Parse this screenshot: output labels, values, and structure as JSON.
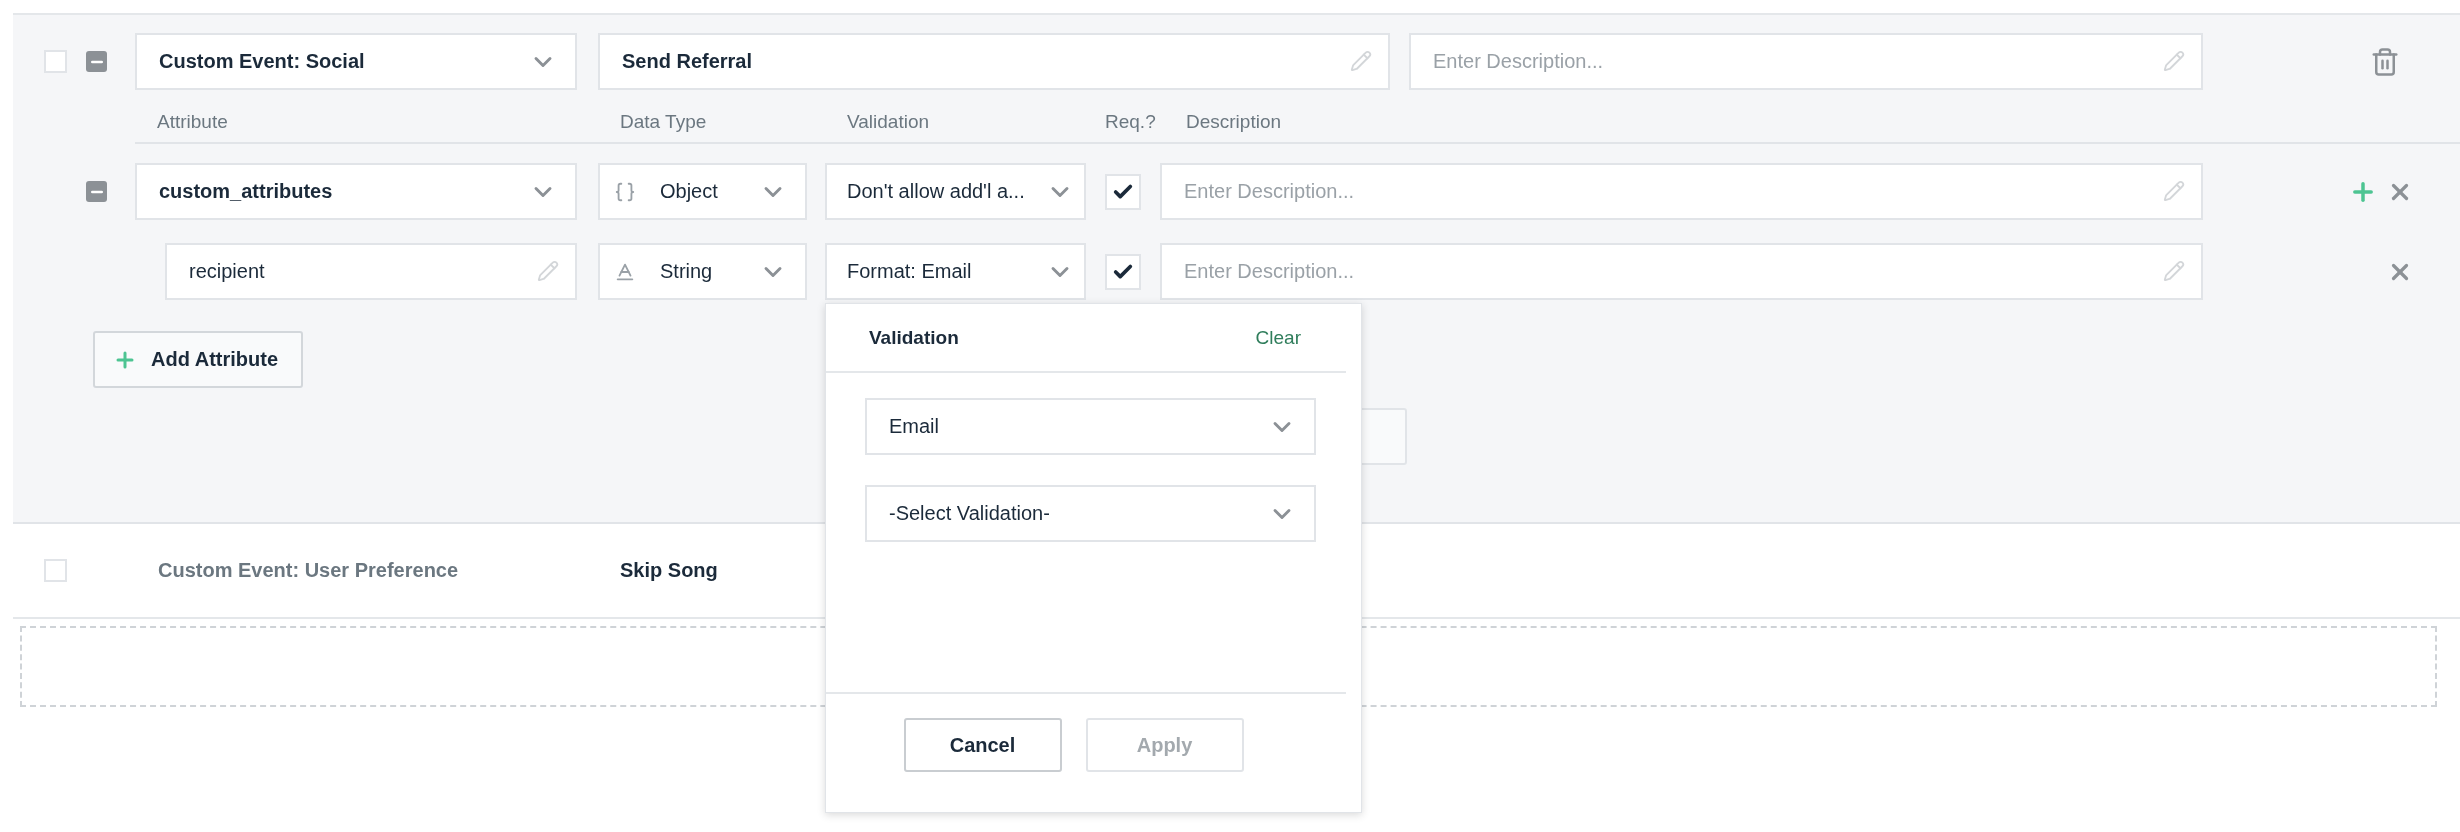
{
  "events": [
    {
      "kind": "editing",
      "selected": false,
      "event_type": "Custom Event: Social",
      "name": "Send Referral",
      "description_placeholder": "Enter Description...",
      "columns": [
        "Attribute",
        "Data Type",
        "Validation",
        "Req.?",
        "Description"
      ],
      "attributes": [
        {
          "kind": "object",
          "expanded": true,
          "name": "custom_attributes",
          "data_type": "Object",
          "validation": "Don't allow add'l a...",
          "required": true,
          "description_placeholder": "Enter Description...",
          "children": [
            {
              "kind": "string",
              "name": "recipient",
              "data_type": "String",
              "validation": "Format: Email",
              "required": true,
              "description_placeholder": "Enter Description..."
            }
          ]
        }
      ],
      "add_button": "Add Attribute"
    },
    {
      "kind": "summary",
      "selected": false,
      "event_type": "Custom Event: User Preference",
      "name": "Skip Song"
    }
  ],
  "validation_popover": {
    "title": "Validation",
    "clear": "Clear",
    "selects": [
      {
        "value": "Email"
      },
      {
        "value": "-Select Validation-"
      }
    ],
    "buttons": [
      {
        "label": "Cancel",
        "disabled": false
      },
      {
        "label": "Apply",
        "disabled": true
      }
    ]
  }
}
